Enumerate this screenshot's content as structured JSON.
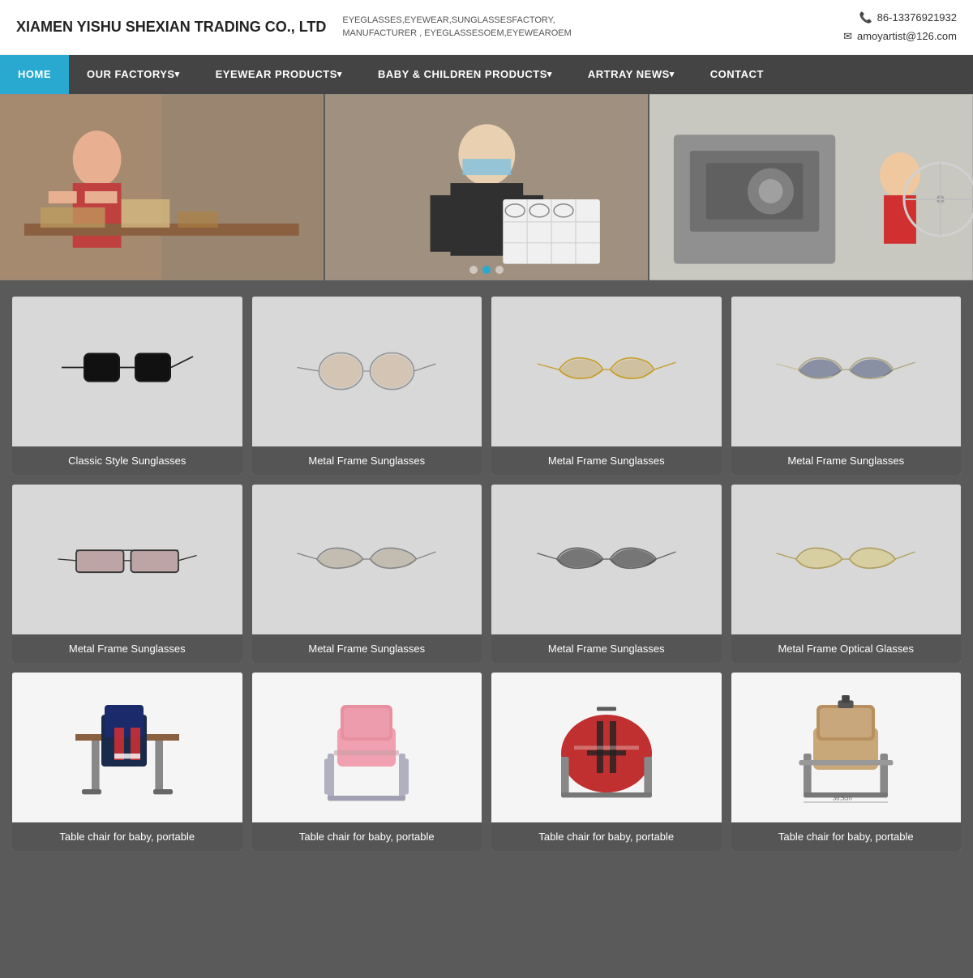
{
  "header": {
    "logo": "XIAMEN YISHU SHEXIAN TRADING CO., LTD",
    "tagline_line1": "EYEGLASSES,EYEWEAR,SUNGLASSESFACTORY,",
    "tagline_line2": "MANUFACTURER , EYEGLASSESOEM,EYEWEAROEM",
    "phone": "86-13376921932",
    "email": "amoyartist@126.com"
  },
  "nav": {
    "items": [
      {
        "label": "HOME",
        "active": true,
        "hasDropdown": false
      },
      {
        "label": "OUR FACTORYS",
        "active": false,
        "hasDropdown": true
      },
      {
        "label": "EYEWEAR PRODUCTS",
        "active": false,
        "hasDropdown": true
      },
      {
        "label": "BABY & CHILDREN PRODUCTS",
        "active": false,
        "hasDropdown": true
      },
      {
        "label": "ARTRAY NEWS",
        "active": false,
        "hasDropdown": true
      },
      {
        "label": "CONTACT",
        "active": false,
        "hasDropdown": false
      }
    ]
  },
  "products": [
    {
      "id": 1,
      "label": "Classic Style Sunglasses",
      "type": "sunglass-black-square"
    },
    {
      "id": 2,
      "label": "Metal Frame Sunglasses",
      "type": "sunglass-round-brown"
    },
    {
      "id": 3,
      "label": "Metal Frame Sunglasses",
      "type": "sunglass-aviator-gold"
    },
    {
      "id": 4,
      "label": "Metal Frame Sunglasses",
      "type": "sunglass-aviator-blue"
    },
    {
      "id": 5,
      "label": "Metal Frame Sunglasses",
      "type": "sunglass-wide-red"
    },
    {
      "id": 6,
      "label": "Metal Frame Sunglasses",
      "type": "sunglass-aviator-brown"
    },
    {
      "id": 7,
      "label": "Metal Frame Sunglasses",
      "type": "sunglass-aviator-dark"
    },
    {
      "id": 8,
      "label": "Metal Frame Optical Glasses",
      "type": "sunglass-aviator-yellow"
    },
    {
      "id": 9,
      "label": "Table chair for baby, portable",
      "type": "baby-chair-dark"
    },
    {
      "id": 10,
      "label": "Table chair for baby, portable",
      "type": "baby-chair-pink"
    },
    {
      "id": 11,
      "label": "Table chair for baby, portable",
      "type": "baby-chair-red"
    },
    {
      "id": 12,
      "label": "Table chair for baby, portable",
      "type": "baby-chair-brown"
    }
  ]
}
